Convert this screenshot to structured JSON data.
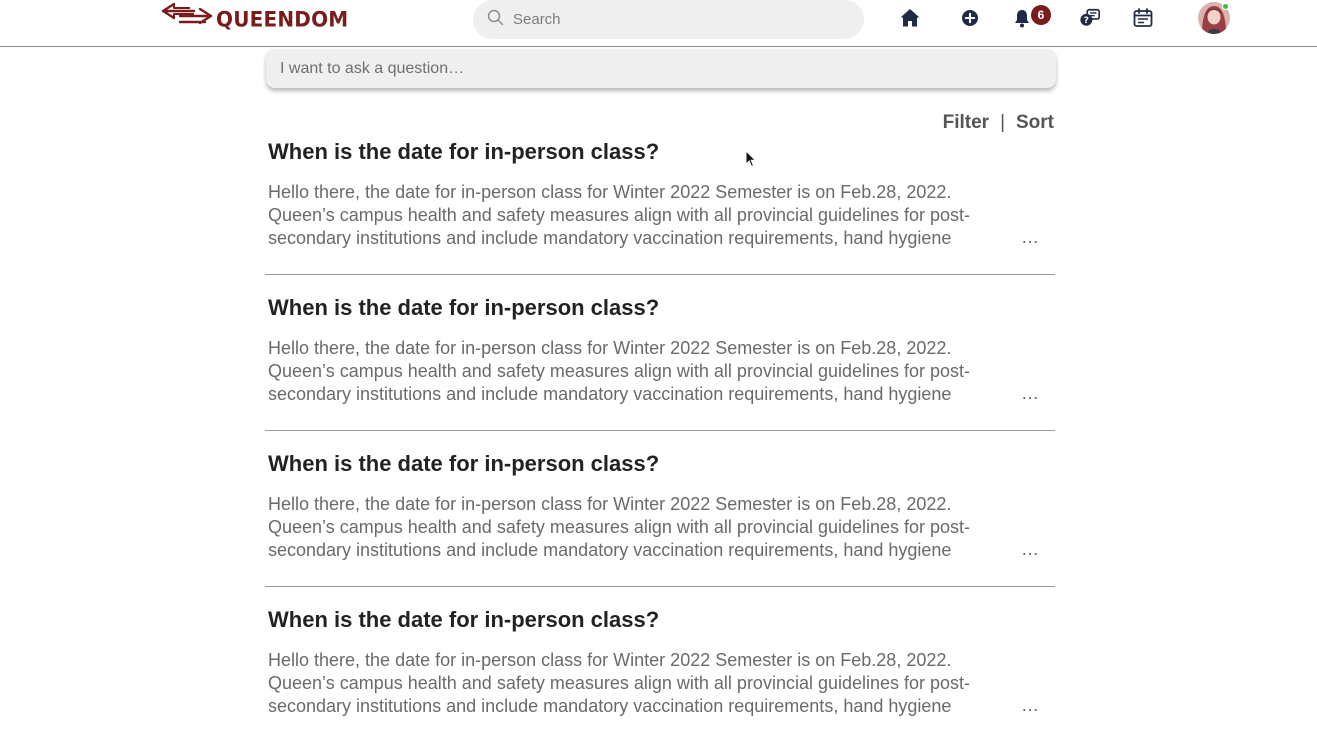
{
  "header": {
    "logo_text": "QUEENDOM",
    "brand_color": "#7a1c1c",
    "search_placeholder": "Search",
    "notification_count": "6",
    "icons": [
      "arrows-logo-icon",
      "search-icon",
      "home-icon",
      "add-circle-icon",
      "bell-icon",
      "chat-question-icon",
      "calendar-icon"
    ]
  },
  "ask": {
    "placeholder": "I want to ask a question…"
  },
  "controls": {
    "filter": "Filter",
    "separator": "|",
    "sort": "Sort"
  },
  "posts": [
    {
      "title": "When is the date for in-person class?",
      "lines": [
        "Hello there, the date for in-person class for Winter 2022 Semester is on Feb.28, 2022.",
        "Queen’s campus health and safety measures align with all provincial guidelines for post-",
        "secondary institutions and include mandatory vaccination requirements, hand hygiene"
      ],
      "more": "…"
    },
    {
      "title": "When is the date for in-person class?",
      "lines": [
        "Hello there, the date for in-person class for Winter 2022 Semester is on Feb.28, 2022.",
        "Queen’s campus health and safety measures align with all provincial guidelines for post-",
        "secondary institutions and include mandatory vaccination requirements, hand hygiene"
      ],
      "more": "…"
    },
    {
      "title": "When is the date for in-person class?",
      "lines": [
        "Hello there, the date for in-person class for Winter 2022 Semester is on Feb.28, 2022.",
        "Queen’s campus health and safety measures align with all provincial guidelines for post-",
        "secondary institutions and include mandatory vaccination requirements, hand hygiene"
      ],
      "more": "…"
    },
    {
      "title": "When is the date for in-person class?",
      "lines": [
        "Hello there, the date for in-person class for Winter 2022 Semester is on Feb.28, 2022.",
        "Queen’s campus health and safety measures align with all provincial guidelines for post-",
        "secondary institutions and include mandatory vaccination requirements, hand hygiene"
      ],
      "more": "…"
    }
  ]
}
